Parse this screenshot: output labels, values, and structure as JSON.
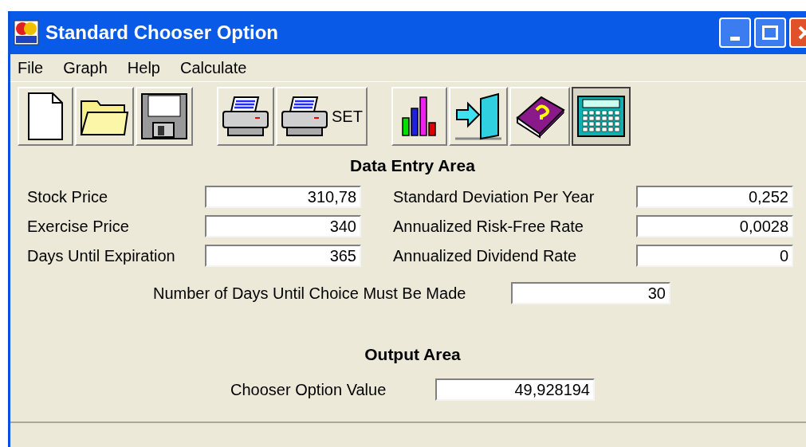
{
  "window": {
    "title": "Standard Chooser Option"
  },
  "menu": [
    "File",
    "Graph",
    "Help",
    "Calculate"
  ],
  "toolbar": [
    [
      {
        "kind": "new",
        "pressed": false
      },
      {
        "kind": "open",
        "pressed": false
      },
      {
        "kind": "save",
        "pressed": false
      }
    ],
    [
      {
        "kind": "print",
        "pressed": false
      },
      {
        "kind": "print_setup",
        "label": "SET",
        "pressed": false
      }
    ],
    [
      {
        "kind": "chart",
        "pressed": false
      },
      {
        "kind": "exit",
        "pressed": false
      },
      {
        "kind": "help",
        "pressed": false
      },
      {
        "kind": "calculator",
        "pressed": true
      }
    ]
  ],
  "data_entry": {
    "title": "Data Entry Area",
    "left": [
      {
        "label": "Stock Price",
        "value": "310,78"
      },
      {
        "label": "Exercise Price",
        "value": "340"
      },
      {
        "label": "Days Until Expiration",
        "value": "365"
      }
    ],
    "right": [
      {
        "label": "Standard Deviation Per Year",
        "value": "0,252"
      },
      {
        "label": "Annualized Risk-Free Rate",
        "value": "0,0028"
      },
      {
        "label": "Annualized Dividend Rate",
        "value": "0"
      }
    ],
    "choice": {
      "label": "Number of Days Until Choice Must Be Made",
      "value": "30"
    }
  },
  "output": {
    "title": "Output Area",
    "label": "Chooser Option Value",
    "value": "49,928194"
  }
}
